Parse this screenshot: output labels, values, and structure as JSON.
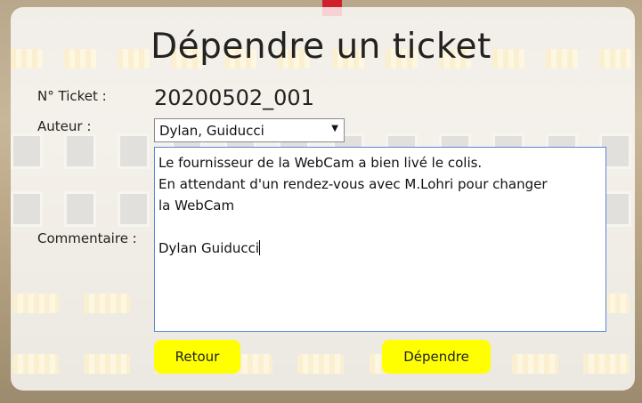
{
  "page": {
    "title": "Dépendre un ticket"
  },
  "form": {
    "ticket_label": "N° Ticket :",
    "ticket_value": "20200502_001",
    "author_label": "Auteur :",
    "author_selected": "Dylan, Guiducci",
    "comment_label": "Commentaire :",
    "comment_lines": [
      "Le fournisseur de la WebCam a bien livé le colis.",
      "En attendant d'un rendez-vous avec M.Lohri pour changer",
      "la WebCam",
      "",
      "Dylan Guiducci"
    ]
  },
  "buttons": {
    "back_label": "Retour",
    "submit_label": "Dépendre"
  },
  "colors": {
    "button_bg": "#ffff00",
    "textarea_border": "#5b87d6"
  },
  "icons": {
    "select_arrow": "chevron-down-icon"
  }
}
